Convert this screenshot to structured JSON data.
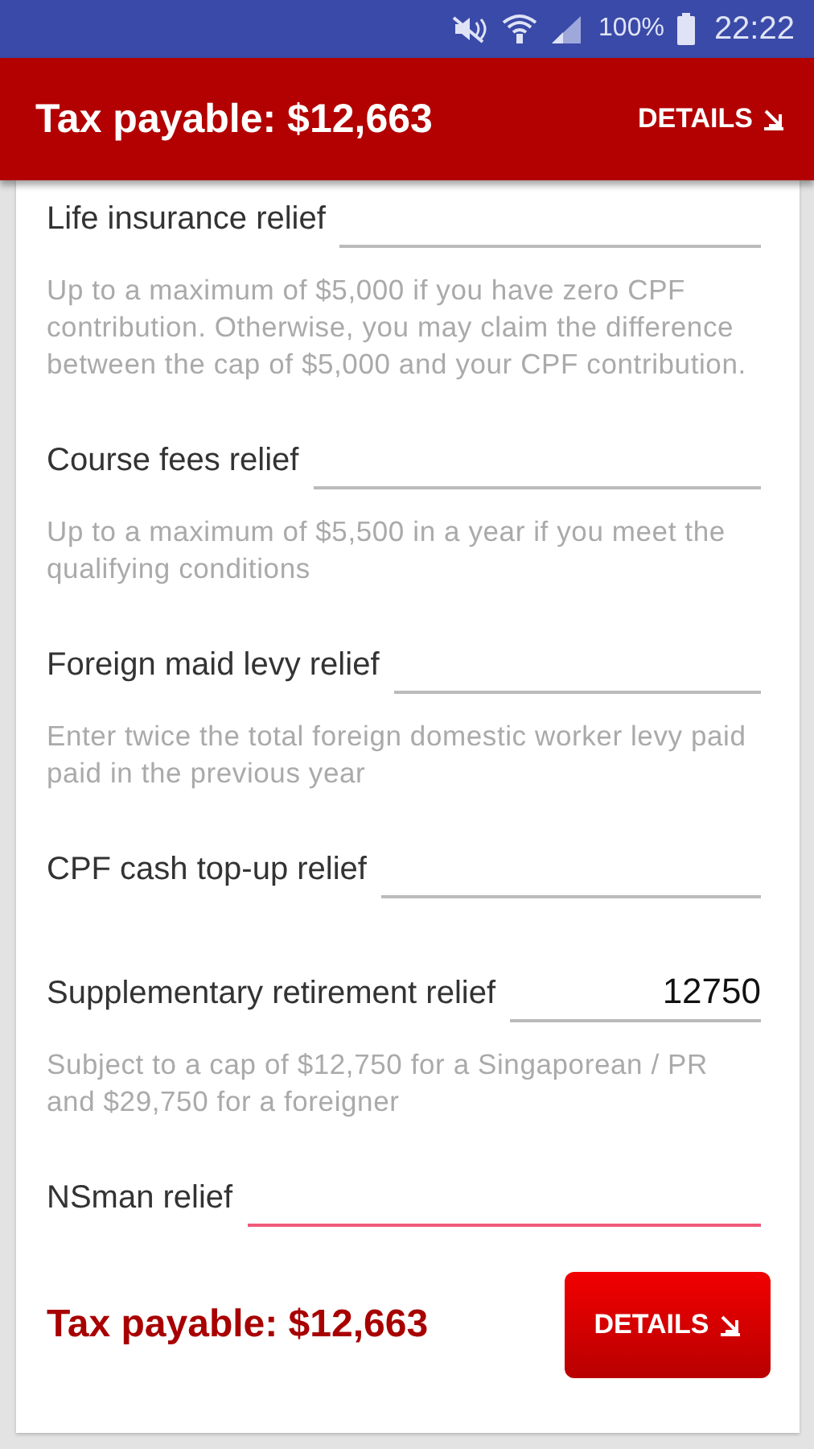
{
  "status_bar": {
    "battery": "100%",
    "time": "22:22"
  },
  "header": {
    "title": "Tax payable: $12,663",
    "button": "DETAILS"
  },
  "fields": [
    {
      "label": "Life insurance relief",
      "focused": false,
      "help": "Up to a maximum of $5,000 if you have zero CPF contribution. Otherwise, you may claim the difference between the cap of $5,000 and your CPF contribution."
    },
    {
      "label": "Course fees relief",
      "focused": false,
      "help": "Up to a maximum of $5,500 in a year if you meet the qualifying conditions"
    },
    {
      "label": "Foreign maid levy relief",
      "focused": false,
      "help": "Enter twice the total foreign domestic worker levy paid paid in the previous year"
    },
    {
      "label": "CPF cash top-up relief",
      "focused": false
    },
    {
      "label": "Supplementary retirement relief",
      "value": "12750",
      "focused": false,
      "help": "Subject to a cap of $12,750 for a Singaporean / PR and $29,750 for a foreigner"
    },
    {
      "label": "NSman relief",
      "focused": true
    }
  ],
  "footer": {
    "title": "Tax payable: $12,663",
    "button": "DETAILS"
  }
}
